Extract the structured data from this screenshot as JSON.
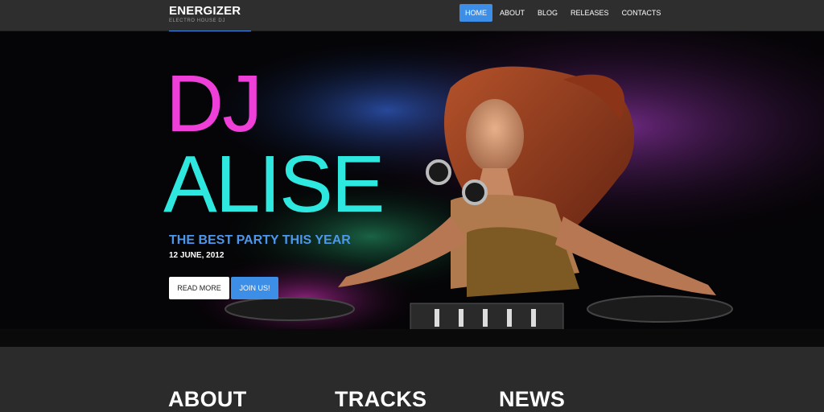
{
  "brand": {
    "title": "ENERGIZER",
    "subtitle": "ELECTRO HOUSE DJ"
  },
  "nav": {
    "items": [
      {
        "label": "HOME",
        "active": true
      },
      {
        "label": "ABOUT"
      },
      {
        "label": "BLOG"
      },
      {
        "label": "RELEASES"
      },
      {
        "label": "CONTACTS"
      }
    ]
  },
  "hero": {
    "title_line1": "DJ",
    "title_line2": "ALISE",
    "tagline": "THE BEST PARTY THIS YEAR",
    "date": "12 JUNE, 2012",
    "read_more_label": "READ MORE",
    "join_label": "JOIN US!"
  },
  "sections": {
    "about": "ABOUT",
    "tracks": "TRACKS",
    "news": "NEWS"
  },
  "colors": {
    "accent": "#3d8ee6",
    "title_pink": "#ef3fd9",
    "title_cyan": "#2ee7df",
    "background": "#2b2b2b"
  }
}
